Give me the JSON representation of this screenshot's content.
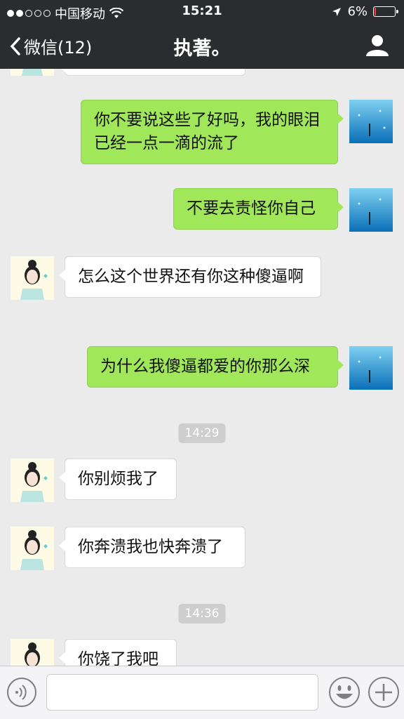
{
  "status_bar": {
    "carrier": "中国移动",
    "time": "15:21",
    "battery": "6%",
    "battery_level": 0.06
  },
  "nav": {
    "back_label": "微信(12)",
    "title": "执著。"
  },
  "messages": [
    {
      "from": "me",
      "text": "你不要说这些了好吗，我的眼泪已经一点一滴的流了"
    },
    {
      "from": "me",
      "text": "不要去责怪你自己"
    },
    {
      "from": "her",
      "text": "怎么这个世界还有你这种傻逼啊"
    },
    {
      "from": "me",
      "text": "为什么我傻逼都爱的你那么深"
    },
    {
      "type": "time",
      "text": "14:29"
    },
    {
      "from": "her",
      "text": "你别烦我了"
    },
    {
      "from": "her",
      "text": "你奔溃我也快奔溃了"
    },
    {
      "type": "time",
      "text": "14:36"
    },
    {
      "from": "her",
      "text": "你饶了我吧"
    }
  ],
  "colors": {
    "nav_bg": "#2b2c30",
    "chat_bg": "#ebebeb",
    "my_bubble": "#a0e75a",
    "her_bubble": "#ffffff",
    "battery_low": "#ff3b30"
  },
  "icons": {
    "back": "chevron-left-icon",
    "profile": "person-icon",
    "voice": "voice-icon",
    "emoji": "smiley-icon",
    "more": "plus-icon"
  }
}
